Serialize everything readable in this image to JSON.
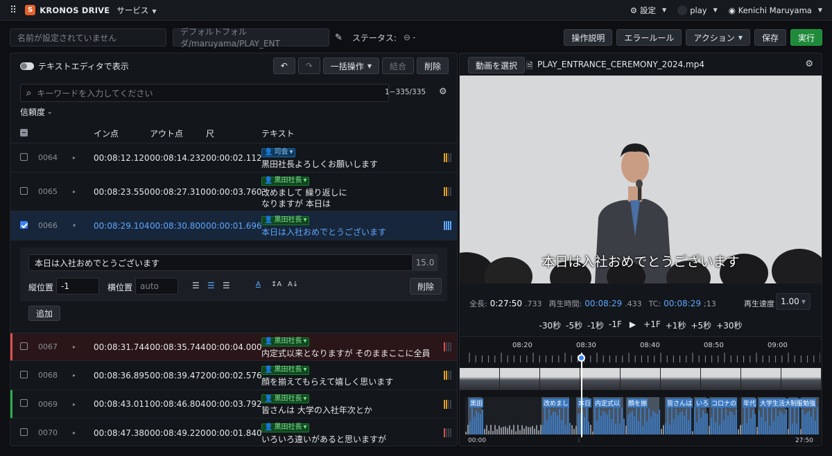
{
  "topbar": {
    "app": "KRONOS DRIVE",
    "service": "サービス",
    "settings": "設定",
    "user_play": "play",
    "user_name": "Kenichi Maruyama"
  },
  "header": {
    "name_placeholder": "名前が設定されていません",
    "folder": "デフォルトフォルダ/maruyama/PLAY_ENT",
    "status_label": "ステータス:",
    "status_value": "-",
    "btn_help": "操作説明",
    "btn_error": "エラールール",
    "btn_action": "アクション",
    "btn_save": "保存",
    "btn_run": "実行"
  },
  "left": {
    "toggle_label": "テキストエディタで表示",
    "btn_bulk": "一括操作",
    "btn_merge": "結合",
    "btn_delete": "削除",
    "search_placeholder": "キーワードを入力してください",
    "count": "1−335/335",
    "confidence": "信頼度",
    "columns": {
      "in": "イン点",
      "out": "アウト点",
      "dur": "尺",
      "text": "テキスト"
    },
    "rows": [
      {
        "id": "0064",
        "in": "00:08:12.120",
        "out": "00:08:14.232",
        "dur": "00:00:02.112",
        "speaker": "司会",
        "text1": "黒田社長よろしくお願いします",
        "text2": ""
      },
      {
        "id": "0065",
        "in": "00:08:23.550",
        "out": "00:08:27.310",
        "dur": "00:00:03.760",
        "speaker": "黒田社長",
        "text1": "改めまして 繰り返しに",
        "text2": "なりますが 本日は"
      },
      {
        "id": "0066",
        "in": "00:08:29.104",
        "out": "00:08:30.800",
        "dur": "00:00:01.696",
        "speaker": "黒田社長",
        "text1": "本日は入社おめでとうございます",
        "text2": ""
      },
      {
        "id": "0067",
        "in": "00:08:31.744",
        "out": "00:08:35.744",
        "dur": "00:00:04.000",
        "speaker": "黒田社長",
        "text1": "内定式以来となりますが そのままここに全員",
        "text2": ""
      },
      {
        "id": "0068",
        "in": "00:08:36.895",
        "out": "00:08:39.472",
        "dur": "00:00:02.576",
        "speaker": "黒田社長",
        "text1": "顔を揃えてもらえて嬉しく思います",
        "text2": ""
      },
      {
        "id": "0069",
        "in": "00:08:43.011",
        "out": "00:08:46.804",
        "dur": "00:00:03.792",
        "speaker": "黒田社長",
        "text1": "皆さんは 大学の入社年次とか",
        "text2": ""
      },
      {
        "id": "0070",
        "in": "00:08:47.380",
        "out": "00:08:49.220",
        "dur": "00:00:01.840",
        "speaker": "黒田社長",
        "text1": "いろいろ違いがあると思いますが",
        "text2": ""
      }
    ],
    "editor": {
      "text": "本日は入社おめでとうございます",
      "size": "15.0",
      "vpos_label": "縦位置",
      "vpos": "-1",
      "hpos_label": "横位置",
      "hpos_placeholder": "auto",
      "delete": "削除",
      "add": "追加"
    }
  },
  "right": {
    "btn_select": "動画を選択",
    "filename": "PLAY_ENTRANCE_CEREMONY_2024.mp4",
    "subtitle": "本日は入社おめでとうございます",
    "total_label": "全長:",
    "total": "0:27:50",
    "total_ms": ".733",
    "play_label": "再生時間:",
    "play": "00:08:29",
    "play_ms": ".433",
    "tc_label": "TC:",
    "tc": "00:08:29",
    "tc_f": ";13",
    "speed_label": "再生速度",
    "speed": "1.00",
    "jumps": [
      "-30秒",
      "-5秒",
      "-1秒",
      "-1F",
      "▶",
      "+1F",
      "+1秒",
      "+5秒",
      "+30秒"
    ],
    "ticks": [
      "08:20",
      "08:30",
      "08:40",
      "08:50",
      "09:00"
    ],
    "segments": [
      "黒田",
      "改めまし",
      "本日",
      "内定式以",
      "顔を揃",
      "皆さんは",
      "いろ",
      "コロナの",
      "年代",
      "大学生活大",
      "制服",
      "勉強"
    ],
    "start": "00:00",
    "end": "27:50"
  }
}
